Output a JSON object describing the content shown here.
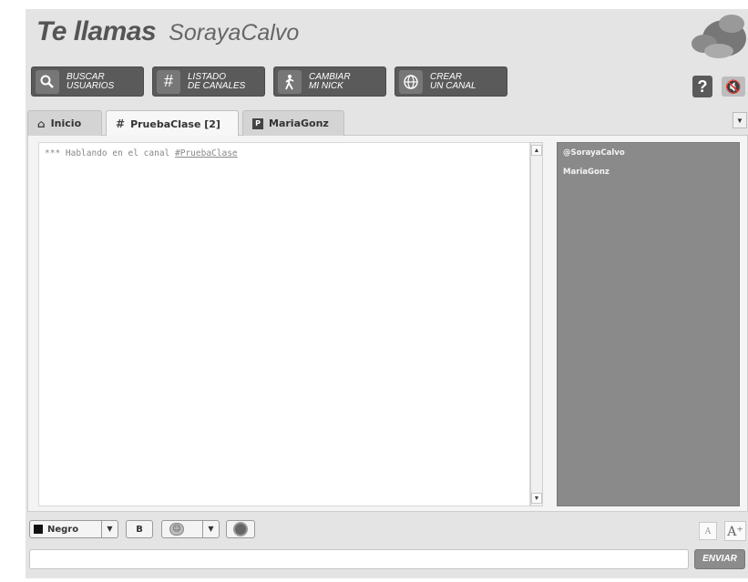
{
  "header": {
    "title_label": "Te llamas",
    "nick": "SorayaCalvo"
  },
  "toolbar": {
    "buttons": [
      {
        "label_line1": "BUSCAR",
        "label_line2": "USUARIOS",
        "icon": "search-icon"
      },
      {
        "label_line1": "LISTADO",
        "label_line2": "DE CANALES",
        "icon": "hash-icon"
      },
      {
        "label_line1": "CAMBIAR",
        "label_line2": "MI NICK",
        "icon": "walking-person-icon"
      },
      {
        "label_line1": "CREAR",
        "label_line2": "UN CANAL",
        "icon": "globe-icon"
      }
    ],
    "help_label": "?"
  },
  "tabs": [
    {
      "label": "Inicio",
      "icon": "home-icon"
    },
    {
      "label": "PruebaClase [2]",
      "icon": "hash-icon"
    },
    {
      "label": "MariaGonz",
      "icon": "private-chat-icon"
    }
  ],
  "chat": {
    "message_prefix": "*** Hablando en el canal",
    "channel_link": "#PruebaClase"
  },
  "users": [
    "@SorayaCalvo",
    "MariaGonz"
  ],
  "composer": {
    "color_label": "Negro",
    "bold_label": "B",
    "font_small_label": "A",
    "font_large_label": "A⁺",
    "send_label": "ENVIAR",
    "input_value": ""
  }
}
